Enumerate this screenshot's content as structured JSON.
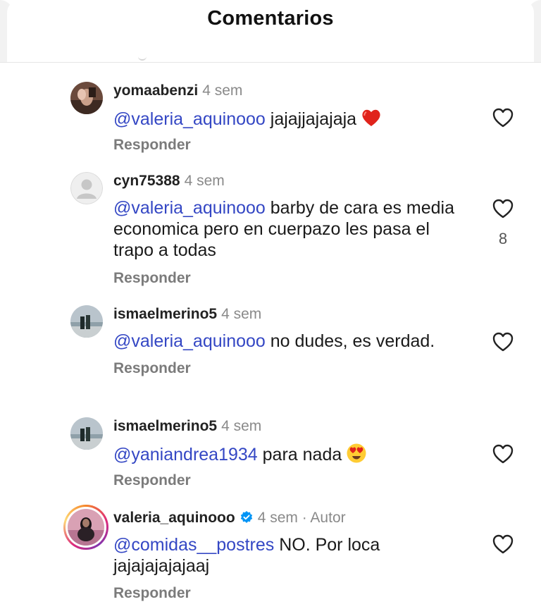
{
  "header": {
    "title": "Comentarios"
  },
  "comments": [
    {
      "username": "yomaabenzi",
      "time": "4 sem",
      "mention": "@valeria_aquinooo",
      "text": " jajajjajajaja",
      "emoji": "red-heart",
      "reply_label": "Responder",
      "likes": ""
    },
    {
      "username": "cyn75388",
      "time": "4 sem",
      "mention": "@valeria_aquinooo",
      "text": " barby de cara es media economica pero en cuerpazo les pasa el trapo a todas",
      "reply_label": "Responder",
      "likes": "8"
    },
    {
      "username": "ismaelmerino5",
      "time": "4 sem",
      "mention": "@valeria_aquinooo",
      "text": " no dudes, es verdad.",
      "reply_label": "Responder",
      "likes": ""
    },
    {
      "username": "ismaelmerino5",
      "time": "4 sem",
      "mention": "@yaniandrea1934",
      "text": " para nada",
      "emoji": "heart-eyes",
      "reply_label": "Responder",
      "likes": ""
    },
    {
      "username": "valeria_aquinooo",
      "time": "4 sem",
      "author_label": "· Autor",
      "mention": "@comidas__postres",
      "text": " NO. Por loca jajajajajajaaj",
      "reply_label": "Responder",
      "likes": "",
      "verified": true
    }
  ],
  "colors": {
    "mention": "#3447c4",
    "verified": "#0095f6",
    "muted": "#8a8a8a"
  }
}
